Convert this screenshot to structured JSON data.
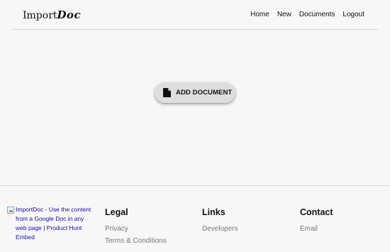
{
  "header": {
    "logo_prefix": "Import",
    "logo_suffix": "Doc",
    "nav": [
      "Home",
      "New",
      "Documents",
      "Logout"
    ]
  },
  "main": {
    "add_button_label": "ADD DOCUMENT",
    "add_button_icon": "document-icon"
  },
  "footer": {
    "embed_alt_text": "ImportDoc - Use the content from a Google Doc in any web page | Product Hunt Embed",
    "legal": {
      "heading": "Legal",
      "links": [
        "Privacy",
        "Terms & Conditions"
      ]
    },
    "links": {
      "heading": "Links",
      "links": [
        "Developers"
      ]
    },
    "contact": {
      "heading": "Contact",
      "links": [
        "Email"
      ]
    }
  },
  "colors": {
    "background": "#f7f7f7",
    "button_bg": "#dedede",
    "footer_link": "#777777",
    "embed_link": "#1a0dab"
  }
}
